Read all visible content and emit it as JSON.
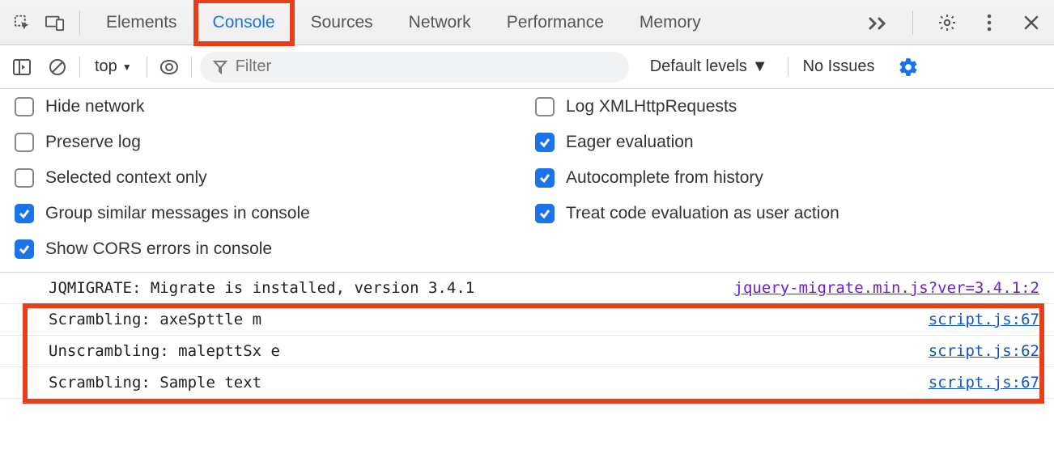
{
  "tabs": {
    "elements": "Elements",
    "console": "Console",
    "sources": "Sources",
    "network": "Network",
    "performance": "Performance",
    "memory": "Memory"
  },
  "toolbar": {
    "context": "top",
    "filter_placeholder": "Filter",
    "levels": "Default levels",
    "issues": "No Issues"
  },
  "settings": {
    "hide_network": {
      "label": "Hide network",
      "checked": false
    },
    "log_xhr": {
      "label": "Log XMLHttpRequests",
      "checked": false
    },
    "preserve_log": {
      "label": "Preserve log",
      "checked": false
    },
    "eager_eval": {
      "label": "Eager evaluation",
      "checked": true
    },
    "selected_context": {
      "label": "Selected context only",
      "checked": false
    },
    "autocomplete": {
      "label": "Autocomplete from history",
      "checked": true
    },
    "group_similar": {
      "label": "Group similar messages in console",
      "checked": true
    },
    "treat_eval": {
      "label": "Treat code evaluation as user action",
      "checked": true
    },
    "show_cors": {
      "label": "Show CORS errors in console",
      "checked": true
    }
  },
  "logs": [
    {
      "msg": "JQMIGRATE: Migrate is installed, version 3.4.1",
      "src": "jquery-migrate.min.js?ver=3.4.1:2",
      "violet": true
    },
    {
      "msg": "Scrambling: axeSpttle m",
      "src": "script.js:67",
      "violet": false
    },
    {
      "msg": "Unscrambling: malepttSx e",
      "src": "script.js:62",
      "violet": false
    },
    {
      "msg": "Scrambling: Sample text",
      "src": "script.js:67",
      "violet": false
    }
  ]
}
